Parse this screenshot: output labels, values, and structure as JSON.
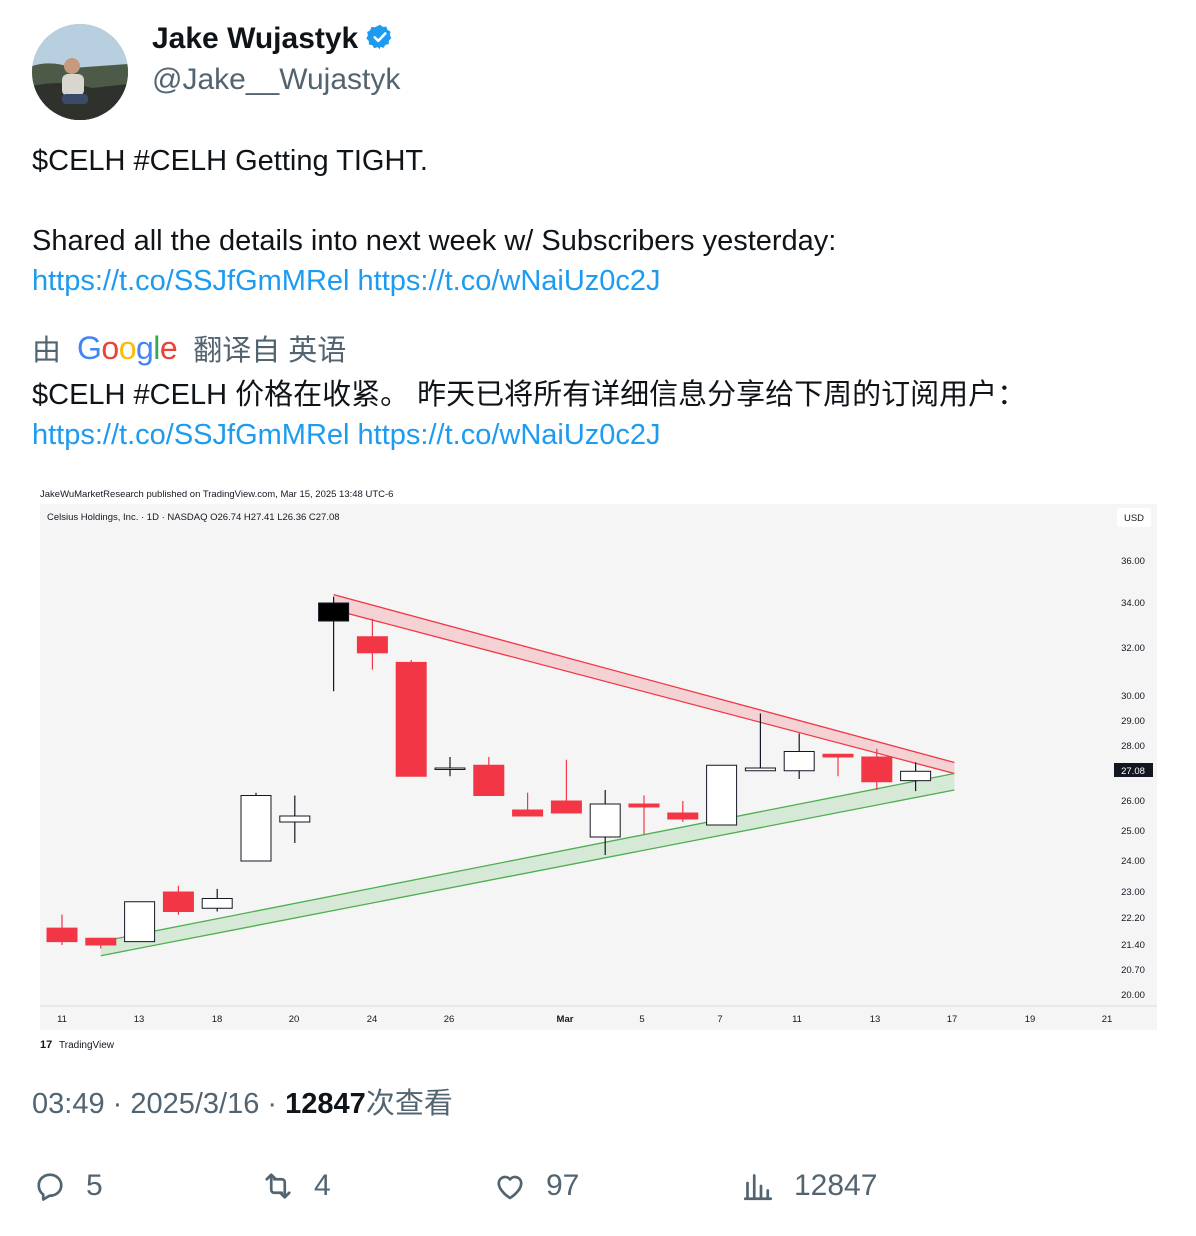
{
  "author": {
    "name": "Jake Wujastyk",
    "handle": "@Jake__Wujastyk"
  },
  "tweet": {
    "line1": "$CELH #CELH Getting TIGHT.",
    "line2": "Shared all the details into next week w/ Subscribers yesterday:",
    "link1": "https://t.co/SSJfGmMRel",
    "link2": "https://t.co/wNaiUz0c2J"
  },
  "translation": {
    "by": "由",
    "google": "Google",
    "from": "翻译自 英语",
    "text": "$CELH #CELH 价格在收紧。 昨天已将所有详细信息分享给下周的订阅用户：",
    "link1": "https://t.co/SSJfGmMRel",
    "link2": "https://t.co/wNaiUz0c2J"
  },
  "chart_header": {
    "published": "JakeWuMarketResearch published on TradingView.com, Mar 15, 2025 13:48 UTC-6",
    "symbol_info": "Celsius Holdings, Inc. · 1D · NASDAQ  O26.74  H27.41  L26.36  C27.08",
    "currency": "USD",
    "last_price": "27.08",
    "brand": "TradingView"
  },
  "chart_data": {
    "type": "candlestick",
    "x_labels": [
      "11",
      "13",
      "18",
      "20",
      "24",
      "26",
      "Mar",
      "5",
      "7",
      "11",
      "13",
      "17",
      "19",
      "21"
    ],
    "y_ticks": [
      "36.00",
      "34.00",
      "32.00",
      "30.00",
      "29.00",
      "28.00",
      "26.00",
      "25.00",
      "24.00",
      "23.00",
      "22.20",
      "21.40",
      "20.70",
      "20.00"
    ],
    "candles": [
      {
        "o": 21.9,
        "h": 22.3,
        "l": 21.4,
        "c": 21.5
      },
      {
        "o": 21.6,
        "h": 21.6,
        "l": 21.3,
        "c": 21.4
      },
      {
        "o": 21.5,
        "h": 22.7,
        "l": 21.5,
        "c": 22.7
      },
      {
        "o": 23.0,
        "h": 23.2,
        "l": 22.3,
        "c": 22.4
      },
      {
        "o": 22.5,
        "h": 23.1,
        "l": 22.4,
        "c": 22.8
      },
      {
        "o": 24.0,
        "h": 26.3,
        "l": 24.0,
        "c": 26.2
      },
      {
        "o": 25.3,
        "h": 26.2,
        "l": 24.6,
        "c": 25.5
      },
      {
        "o": 33.2,
        "h": 34.3,
        "l": 30.2,
        "c": 34.0
      },
      {
        "o": 32.5,
        "h": 33.3,
        "l": 31.1,
        "c": 31.8
      },
      {
        "o": 31.4,
        "h": 31.5,
        "l": 26.9,
        "c": 26.9
      },
      {
        "o": 27.2,
        "h": 27.6,
        "l": 26.9,
        "c": 27.2
      },
      {
        "o": 27.3,
        "h": 27.6,
        "l": 26.2,
        "c": 26.2
      },
      {
        "o": 25.7,
        "h": 26.3,
        "l": 25.6,
        "c": 25.5
      },
      {
        "o": 26.0,
        "h": 27.5,
        "l": 25.6,
        "c": 25.6
      },
      {
        "o": 24.8,
        "h": 26.4,
        "l": 24.2,
        "c": 25.9
      },
      {
        "o": 25.9,
        "h": 26.2,
        "l": 24.9,
        "c": 25.8
      },
      {
        "o": 25.6,
        "h": 26.0,
        "l": 25.3,
        "c": 25.4
      },
      {
        "o": 25.2,
        "h": 27.3,
        "l": 25.2,
        "c": 27.3
      },
      {
        "o": 27.1,
        "h": 29.3,
        "l": 27.1,
        "c": 27.2
      },
      {
        "o": 27.1,
        "h": 28.5,
        "l": 26.8,
        "c": 27.8
      },
      {
        "o": 27.7,
        "h": 27.7,
        "l": 26.9,
        "c": 27.6
      },
      {
        "o": 27.6,
        "h": 27.9,
        "l": 26.4,
        "c": 26.7
      },
      {
        "o": 26.74,
        "h": 27.41,
        "l": 26.36,
        "c": 27.08
      }
    ],
    "candle_x_index": [
      0,
      1,
      2,
      3,
      4,
      5,
      6,
      7,
      8,
      9,
      10,
      11,
      12,
      13,
      14,
      15,
      16,
      17,
      18,
      19,
      20,
      21,
      22
    ],
    "resistance_band": {
      "start": {
        "i": 7,
        "upper": 34.4,
        "lower": 33.7
      },
      "end": {
        "i": 23,
        "upper": 27.4,
        "lower": 27.0
      }
    },
    "support_band": {
      "start": {
        "i": 1,
        "upper": 21.5,
        "lower": 21.1
      },
      "end": {
        "i": 23,
        "upper": 27.0,
        "lower": 26.4
      }
    },
    "colors": {
      "up": "#ffffff",
      "down": "#f23645",
      "black": "#000000",
      "resistance": "#f23645",
      "support": "#4caf50"
    }
  },
  "meta": {
    "time": "03:49",
    "date": "2025/3/16",
    "views": "12847",
    "views_suffix": "次查看"
  },
  "actions": {
    "replies": "5",
    "retweets": "4",
    "likes": "97",
    "views": "12847"
  }
}
